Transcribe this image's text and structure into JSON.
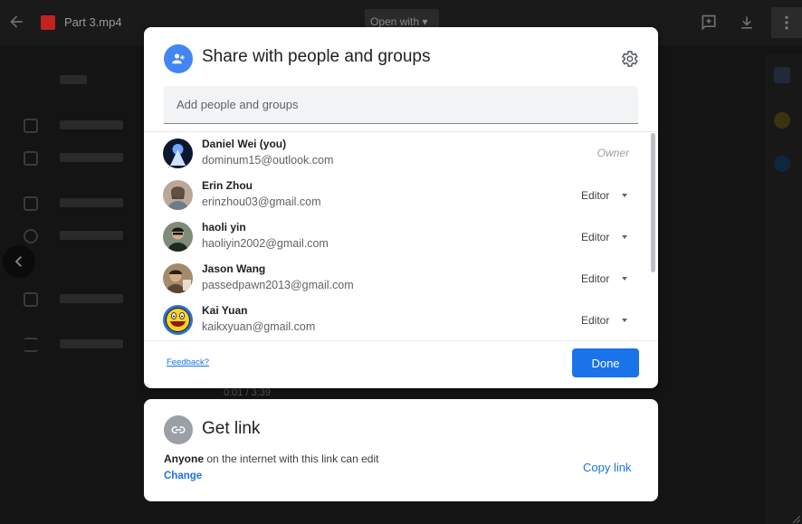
{
  "background": {
    "file_title": "Part 3.mp4",
    "open_with_label": "Open with",
    "player_time": "0:01 / 3:39"
  },
  "dialog": {
    "title": "Share with people and groups",
    "add_placeholder": "Add people and groups",
    "people": [
      {
        "name": "Daniel Wei (you)",
        "email": "dominum15@outlook.com",
        "role": "Owner",
        "avatar_color": "#1b2a4a"
      },
      {
        "name": "Erin Zhou",
        "email": "erinzhou03@gmail.com",
        "role": "Editor",
        "avatar_color": "#8a6d5a"
      },
      {
        "name": "haoli yin",
        "email": "haoliyin2002@gmail.com",
        "role": "Editor",
        "avatar_color": "#4a5a4e"
      },
      {
        "name": "Jason Wang",
        "email": "passedpawn2013@gmail.com",
        "role": "Editor",
        "avatar_color": "#7a6048"
      },
      {
        "name": "Kai Yuan",
        "email": "kaikxyuan@gmail.com",
        "role": "Editor",
        "avatar_color": "#2b6fd6"
      }
    ],
    "feedback_label": "Feedback?",
    "done_label": "Done"
  },
  "get_link": {
    "title": "Get link",
    "desc_bold": "Anyone",
    "desc_rest": " on the internet with this link can edit",
    "change_label": "Change",
    "copy_label": "Copy link"
  },
  "colors": {
    "accent": "#1a73e8",
    "share_icon_bg": "#4285f4",
    "link_icon_bg": "#9aa0a6"
  }
}
